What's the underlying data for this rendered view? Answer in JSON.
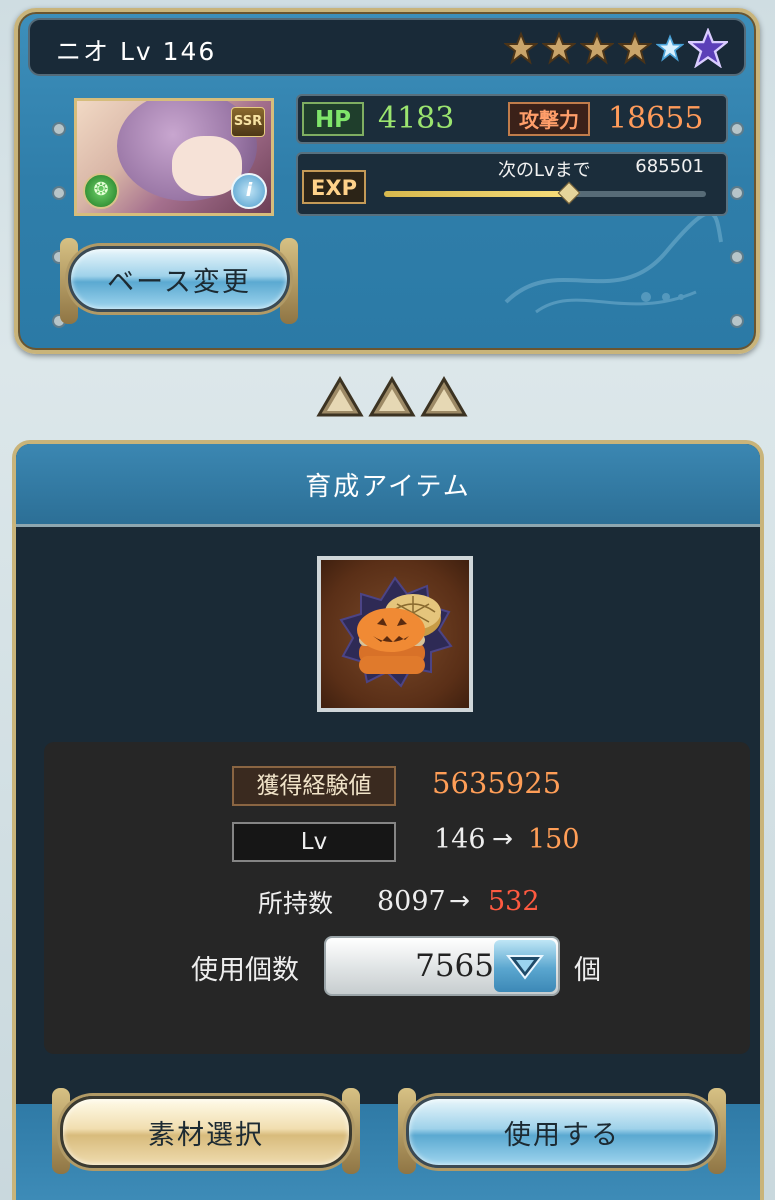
{
  "character": {
    "name_level": "ニオ Lv 146",
    "stars_filled": 4,
    "stars_total": 6,
    "rarity_badge": "SSR",
    "element_icon": "wind-element-icon",
    "info_icon": "i",
    "base_change_label": "ベース変更",
    "hp_label": "HP",
    "hp_value": "4183",
    "atk_label": "攻撃力",
    "atk_value": "18655",
    "exp_label": "EXP",
    "next_level_label": "次のLvまで",
    "next_level_value": "685501",
    "exp_progress": 0.57
  },
  "item_panel": {
    "title": "育成アイテム",
    "item_icon": "halloween-cookie-item",
    "exp_gain_label": "獲得経験値",
    "exp_gain_value": "5635925",
    "lv_label": "Lv",
    "lv_from": "146",
    "lv_arrow": "→",
    "lv_to": "150",
    "owned_label": "所持数",
    "owned_from": "8097",
    "owned_arrow": "→",
    "owned_to": "532",
    "use_count_label": "使用個数",
    "use_count_value": "7565",
    "use_unit": "個",
    "material_select_label": "素材選択",
    "use_button_label": "使用する"
  },
  "colors": {
    "orange_value": "#ff9e57",
    "red_value": "#ff5a40",
    "hp_green": "#9be46f",
    "panel_blue": "#3d8fbb",
    "gold_frame": "#c9b47a"
  }
}
